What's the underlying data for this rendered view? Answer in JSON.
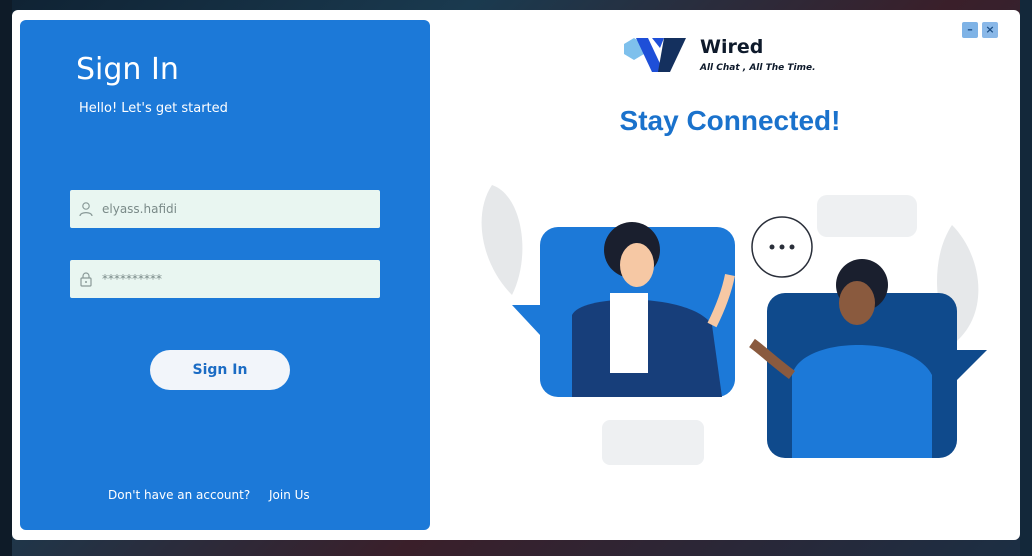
{
  "window": {
    "minimize_label": "–",
    "close_label": "×"
  },
  "signin": {
    "title": "Sign In",
    "subtitle": "Hello! Let's get started",
    "username_value": "elyass.hafidi",
    "password_value": "**********",
    "button_label": "Sign In",
    "no_account_text": "Don't have an account?",
    "join_link": "Join Us"
  },
  "brand": {
    "name": "Wired",
    "tagline": "All Chat , All The Time."
  },
  "headline": "Stay Connected!",
  "colors": {
    "primary": "#1c79d8",
    "headline": "#1a72cc",
    "field_bg": "#e9f6f1",
    "dark_blue": "#0f4a8c"
  },
  "icons": [
    "user-icon",
    "lock-icon",
    "minimize-icon",
    "close-icon"
  ]
}
